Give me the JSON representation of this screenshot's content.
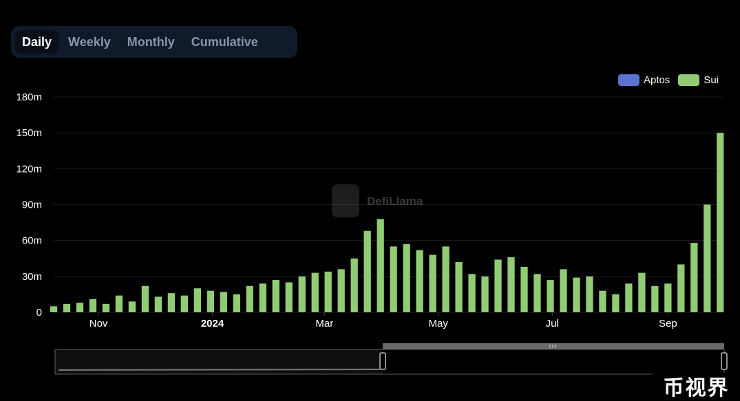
{
  "tabs": [
    {
      "label": "Daily",
      "active": true
    },
    {
      "label": "Weekly",
      "active": false
    },
    {
      "label": "Monthly",
      "active": false
    },
    {
      "label": "Cumulative",
      "active": false
    }
  ],
  "watermark": "DefiLlama",
  "corner_badge": "币视界",
  "colors": {
    "background": "#000000",
    "tab_bar": "#0f1a2a",
    "aptos": "#5b74d1",
    "sui": "#91cc75",
    "grid": "#1c1c1c"
  },
  "chart_data": {
    "type": "bar",
    "stacked": true,
    "ylim": [
      0,
      180
    ],
    "y_unit": "m",
    "y_ticks": [
      0,
      30,
      60,
      90,
      120,
      150,
      180
    ],
    "y_tick_labels": [
      "0",
      "30m",
      "60m",
      "90m",
      "120m",
      "150m",
      "180m"
    ],
    "x_tick_labels": [
      {
        "label": "Nov",
        "date": "2023-11-01"
      },
      {
        "label": "2024",
        "date": "2024-01-01"
      },
      {
        "label": "Mar",
        "date": "2024-03-01"
      },
      {
        "label": "May",
        "date": "2024-05-01"
      },
      {
        "label": "Jul",
        "date": "2024-07-01"
      },
      {
        "label": "Sep",
        "date": "2024-09-01"
      }
    ],
    "x_range": [
      "2023-10-08",
      "2024-09-30"
    ],
    "legend": [
      "Aptos",
      "Sui"
    ],
    "legend_position": "top-right",
    "grid": true,
    "series": [
      {
        "name": "Aptos",
        "color": "#5b74d1",
        "values": []
      },
      {
        "name": "Sui",
        "color": "#91cc75",
        "sampling": "weekly",
        "points": [
          [
            "2023-10-08",
            5
          ],
          [
            "2023-10-15",
            7
          ],
          [
            "2023-10-22",
            8
          ],
          [
            "2023-10-29",
            11
          ],
          [
            "2023-11-05",
            7
          ],
          [
            "2023-11-12",
            14
          ],
          [
            "2023-11-19",
            9
          ],
          [
            "2023-11-26",
            22
          ],
          [
            "2023-12-03",
            13
          ],
          [
            "2023-12-10",
            16
          ],
          [
            "2023-12-17",
            14
          ],
          [
            "2023-12-24",
            20
          ],
          [
            "2023-12-31",
            18
          ],
          [
            "2024-01-07",
            17
          ],
          [
            "2024-01-14",
            15
          ],
          [
            "2024-01-21",
            22
          ],
          [
            "2024-01-28",
            24
          ],
          [
            "2024-02-04",
            27
          ],
          [
            "2024-02-11",
            25
          ],
          [
            "2024-02-18",
            30
          ],
          [
            "2024-02-25",
            33
          ],
          [
            "2024-03-03",
            34
          ],
          [
            "2024-03-10",
            36
          ],
          [
            "2024-03-17",
            45
          ],
          [
            "2024-03-24",
            68
          ],
          [
            "2024-03-31",
            78
          ],
          [
            "2024-04-07",
            55
          ],
          [
            "2024-04-14",
            57
          ],
          [
            "2024-04-21",
            52
          ],
          [
            "2024-04-28",
            48
          ],
          [
            "2024-05-05",
            55
          ],
          [
            "2024-05-12",
            42
          ],
          [
            "2024-05-19",
            32
          ],
          [
            "2024-05-26",
            30
          ],
          [
            "2024-06-02",
            44
          ],
          [
            "2024-06-09",
            46
          ],
          [
            "2024-06-16",
            38
          ],
          [
            "2024-06-23",
            32
          ],
          [
            "2024-06-30",
            27
          ],
          [
            "2024-07-07",
            36
          ],
          [
            "2024-07-14",
            29
          ],
          [
            "2024-07-21",
            30
          ],
          [
            "2024-07-28",
            18
          ],
          [
            "2024-08-04",
            15
          ],
          [
            "2024-08-11",
            24
          ],
          [
            "2024-08-18",
            33
          ],
          [
            "2024-08-25",
            22
          ],
          [
            "2024-09-01",
            24
          ],
          [
            "2024-09-08",
            40
          ],
          [
            "2024-09-15",
            58
          ],
          [
            "2024-09-22",
            90
          ],
          [
            "2024-09-29",
            150
          ]
        ]
      }
    ]
  }
}
